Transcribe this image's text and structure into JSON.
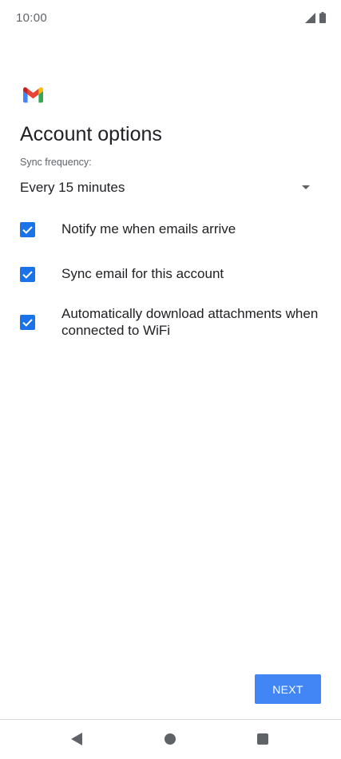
{
  "status_bar": {
    "time": "10:00",
    "icons": [
      "signal-icon",
      "battery-icon"
    ]
  },
  "header": {
    "logo_icon": "gmail-logo-icon",
    "title": "Account options"
  },
  "sync": {
    "label": "Sync frequency:",
    "selected_value": "Every 15 minutes"
  },
  "options": [
    {
      "label": "Notify me when emails arrive",
      "checked": true
    },
    {
      "label": "Sync email for this account",
      "checked": true
    },
    {
      "label": "Automatically download attachments when connected to WiFi",
      "checked": true
    }
  ],
  "actions": {
    "next_label": "NEXT"
  },
  "nav_bar": {
    "icons": [
      "back-icon",
      "home-icon",
      "recents-icon"
    ]
  },
  "colors": {
    "accent": "#1a73e8",
    "button": "#4285f4",
    "text_primary": "#202124",
    "text_secondary": "#5f6368"
  }
}
